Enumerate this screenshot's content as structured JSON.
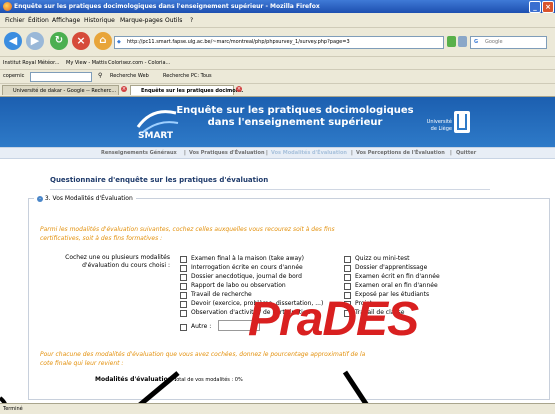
{
  "window": {
    "title": "Enquête sur les pratiques docimologiques dans l'enseignement supérieur - Mozilla Firefox"
  },
  "menu": {
    "items": [
      "Fichier",
      "Édition",
      "Affichage",
      "Historique",
      "Marque-pages",
      "Outils",
      "?"
    ]
  },
  "navigation": {
    "url": "http://pc11.smart.fapse.ulg.ac.be/~marc/montreal/php/phpsurvey_1/survey.php?page=3",
    "search_placeholder": "Google"
  },
  "bookmarks": [
    "Institut Royal Météor...",
    "My View - Mattis",
    "Colorisez.com - Coloria..."
  ],
  "copernic": {
    "label": "copernic",
    "search_web": "Recherche Web",
    "search_pc": "Recherche PC: Tous"
  },
  "tabs": [
    {
      "label": "Université de dakar - Google -- Recherc...",
      "active": false
    },
    {
      "label": "Enquête sur les pratiques docimol...",
      "active": true
    }
  ],
  "banner": {
    "logo_text": "SMART",
    "title_line1": "Enquête sur les pratiques docimologiques",
    "title_line2": "dans l'enseignement supérieur",
    "university_line1": "Université",
    "university_line2": "de Liège"
  },
  "site_nav": {
    "links": [
      "Renseignements Généraux",
      "Vos Pratiques d'Évaluation",
      "Vos Modalités d'Évaluation",
      "Vos Perceptions de l'Évaluation",
      "Quitter"
    ],
    "separator": "|",
    "active_index": 2
  },
  "page": {
    "title": "Questionnaire d'enquête sur les pratiques d'évaluation",
    "section_legend": "3. Vos Modalités d'Évaluation",
    "intro_line1": "Parmi les modalités d'évaluation suivantes, cochez celles auxquelles vous recourez soit à des fins",
    "intro_line2": "certificatives, soit à des fins formatives :",
    "question_line1": "Cochez une ou plusieurs modalités",
    "question_line2": "d'évaluation du cours choisi :",
    "options_left": [
      "Examen final à la maison (take away)",
      "Interrogation écrite en cours d'année",
      "Dossier anecdotique, journal de bord",
      "Rapport de labo ou observation",
      "Travail de recherche",
      "Devoir (exercice, problème, dissertation, ...)",
      "Observation d'activité / de participation",
      "Autre :"
    ],
    "options_right": [
      "Quizz ou mini-test",
      "Dossier d'apprentissage",
      "Examen écrit en fin d'année",
      "Examen oral en fin d'année",
      "Exposé par les étudiants",
      "Projet",
      "Travail de classe"
    ],
    "percent_line1": "Pour chacune des modalités d'évaluation que vous avez cochées, donnez le pourcentage approximatif de la",
    "percent_line2": "cote finale qui leur revient :",
    "modalites_label": "Modalités d'évaluation :",
    "total_text": "Total de vos modalités : 0%"
  },
  "overlay": {
    "text": "PraDES"
  },
  "status": {
    "text": "Terminé"
  },
  "colors": {
    "banner_blue": "#1c5fb0",
    "orange_text": "#e3910d",
    "overlay_red": "#d92020"
  }
}
